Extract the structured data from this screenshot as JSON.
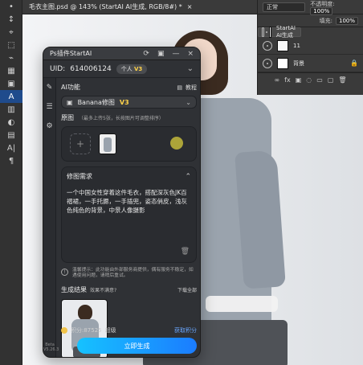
{
  "photoshop": {
    "document_tab": "毛衣主图.psd @ 143% (StartAI AI生成, RGB/8#) *",
    "close": "×",
    "toolbar": {
      "items": [
        "•",
        "↕",
        "⌖",
        "⬚",
        "⌁",
        "▦",
        "▣",
        "A",
        "▥",
        "◐",
        "▤",
        "A|",
        "¶"
      ],
      "active_index": 7
    },
    "layers_panel": {
      "blend_mode": "正常",
      "opacity_label": "不透明度:",
      "opacity_value": "100%",
      "fill_label": "填充:",
      "fill_value": "100%",
      "layers": [
        {
          "name": "StartAI AI生成",
          "selected": true
        },
        {
          "name": "11",
          "selected": false
        },
        {
          "name": "背景",
          "selected": false
        }
      ],
      "footer_icons": [
        "∞",
        "fx",
        "▣",
        "◌",
        "▭",
        "▢",
        "🗑"
      ]
    }
  },
  "plugin": {
    "title": "Ps插件StartAI",
    "title_icons": [
      "⟳",
      "▣",
      "—",
      "×"
    ],
    "uid_label": "UID:",
    "uid_value": "614006124",
    "tier": "个人",
    "tier_badge": "V3",
    "side_icons": [
      "✎",
      "☰",
      "⚙"
    ],
    "version": "Beta V5.26.3",
    "ai_function_label": "AI功能",
    "tutorial_label": "教程",
    "feature_selected": "Banana修图",
    "feature_badge": "V3",
    "original_label": "原图",
    "original_hint": "（最多上传5张，长按图片可调整排序）",
    "prompt_label": "修图需求",
    "prompt_text": "一个中国女性穿着这件毛衣，搭配深灰色JK百褶裙，一手托腮，一手插兜，姿态俏皮，浅灰色纯色的背景，中景人像摄影",
    "notice_text": "温馨提示：此功能由外部服务商提供，偶有服务不稳定，如遇使用问题，请稍后重试。",
    "result_label": "生成结果",
    "result_sub": "效果不满意?",
    "download_all": "下载全部",
    "points_label": "积分:87525",
    "points_sub": "超级",
    "get_points": "获取积分",
    "generate_button": "立即生成"
  }
}
